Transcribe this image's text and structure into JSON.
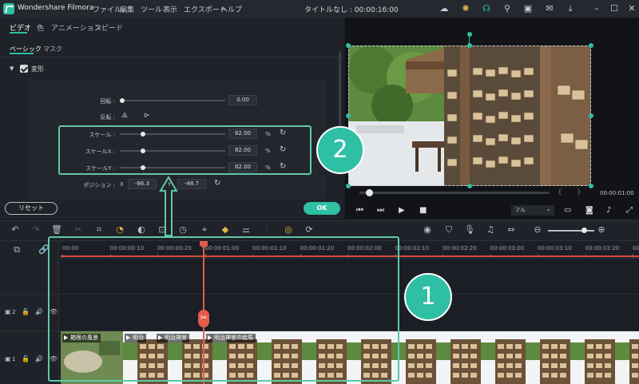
{
  "app": {
    "name": "Wondershare Filmora",
    "window_title": "タイトルなし : 00:00:16:00"
  },
  "menu": [
    "ファイル",
    "編集",
    "ツール",
    "表示",
    "エクスポート",
    "ヘルプ"
  ],
  "title_icons": [
    "cloud-icon",
    "lightbulb-icon",
    "headset-icon",
    "user-icon",
    "save-icon",
    "mail-icon",
    "download-icon",
    "minimize-icon",
    "maximize-icon",
    "close-icon"
  ],
  "editor": {
    "tabs": [
      "ビデオ",
      "色",
      "アニメーション",
      "スピード"
    ],
    "subtabs": [
      "ベーシック",
      "マスク"
    ],
    "section_title": "変形",
    "rotation": {
      "label": "回転 :",
      "value": "0.00"
    },
    "flip": {
      "label": "反転 :"
    },
    "scale": {
      "label": "スケール :",
      "value": "82.00",
      "unit": "%"
    },
    "scale_x": {
      "label": "スケールX :",
      "value": "82.00",
      "unit": "%"
    },
    "scale_y": {
      "label": "スケールY :",
      "value": "82.00",
      "unit": "%"
    },
    "position": {
      "label": "ポジション :",
      "x_label": "X",
      "x_value": "-86.3",
      "y_label": "Y",
      "y_value": "-48.7"
    },
    "reset_label": "リセット",
    "ok_label": "OK"
  },
  "preview": {
    "time": "00:00:01:00",
    "quality": "フル"
  },
  "timeline": {
    "ruler": [
      "00:00",
      "00:00:00:10",
      "00:00:00:20",
      "00:00:01:00",
      "00:00:01:10",
      "00:00:01:20",
      "00:00:02:00",
      "00:00:02:10",
      "00:00:02:20",
      "00:00:03:00",
      "00:00:03:10",
      "00:00:03:20",
      "00:00:04"
    ],
    "tracks": [
      {
        "label": "2",
        "icons": [
          "video-track-icon",
          "lock-icon",
          "speaker-icon",
          "eye-icon"
        ]
      },
      {
        "label": "1",
        "icons": [
          "video-track-icon",
          "lock-icon",
          "speaker-icon",
          "eye-icon"
        ]
      }
    ],
    "clips": [
      "箱根の風景",
      "明治",
      "明治神宮",
      "明治神宮の絵馬"
    ]
  },
  "annotations": {
    "one": "1",
    "two": "2"
  },
  "colors": {
    "accent": "#2fbfa5",
    "playhead": "#e65b4c",
    "annotation": "#5fc9a8"
  }
}
